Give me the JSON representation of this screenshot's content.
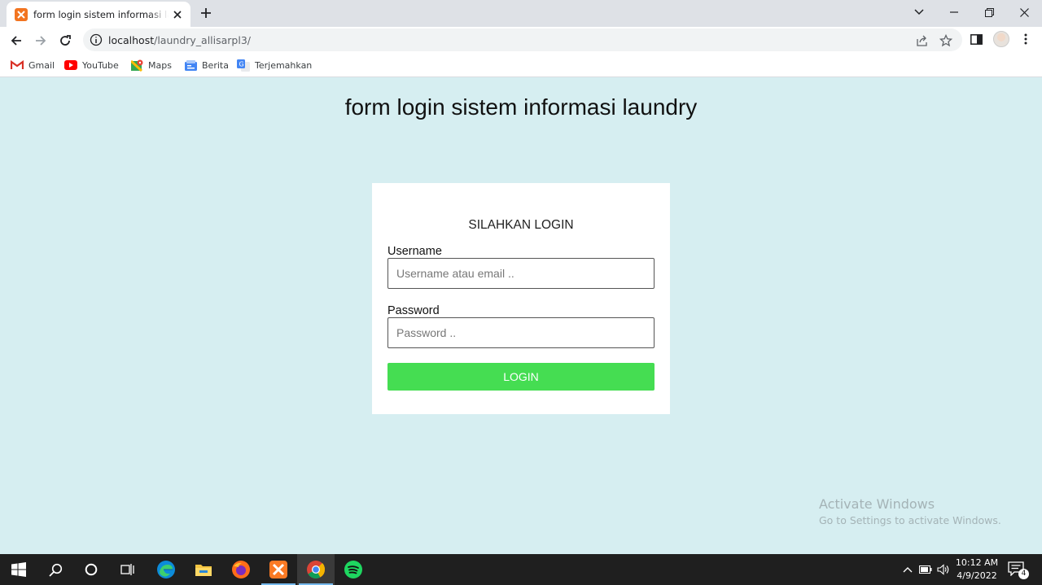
{
  "browser": {
    "tab": {
      "title": "form login sistem informasi laundry"
    },
    "url": {
      "host": "localhost",
      "path": "/laundry_allisarpl3/"
    },
    "bookmarks": [
      {
        "label": "Gmail",
        "icon": "gmail-icon"
      },
      {
        "label": "YouTube",
        "icon": "youtube-icon"
      },
      {
        "label": "Maps",
        "icon": "maps-icon"
      },
      {
        "label": "Berita",
        "icon": "news-icon"
      },
      {
        "label": "Terjemahkan",
        "icon": "translate-icon"
      }
    ]
  },
  "page": {
    "heading": "form login sistem informasi laundry",
    "login": {
      "title": "SILAHKAN LOGIN",
      "username_label": "Username",
      "username_placeholder": "Username atau email ..",
      "password_label": "Password",
      "password_placeholder": "Password ..",
      "button": "LOGIN"
    },
    "watermark": {
      "title": "Activate Windows",
      "subtitle": "Go to Settings to activate Windows."
    }
  },
  "colors": {
    "page_background": "#d6eef1",
    "login_button": "#45dd52",
    "taskbar": "#1f1f1f"
  },
  "taskbar": {
    "apps": [
      "windows-start-icon",
      "search-icon",
      "cortana-icon",
      "task-view-icon",
      "edge-icon",
      "file-explorer-icon",
      "firefox-icon",
      "xampp-icon",
      "chrome-icon",
      "spotify-icon"
    ],
    "active_app": "chrome-icon",
    "clock": {
      "time": "10:12 AM",
      "date": "4/9/2022"
    },
    "notification_count": "4"
  }
}
